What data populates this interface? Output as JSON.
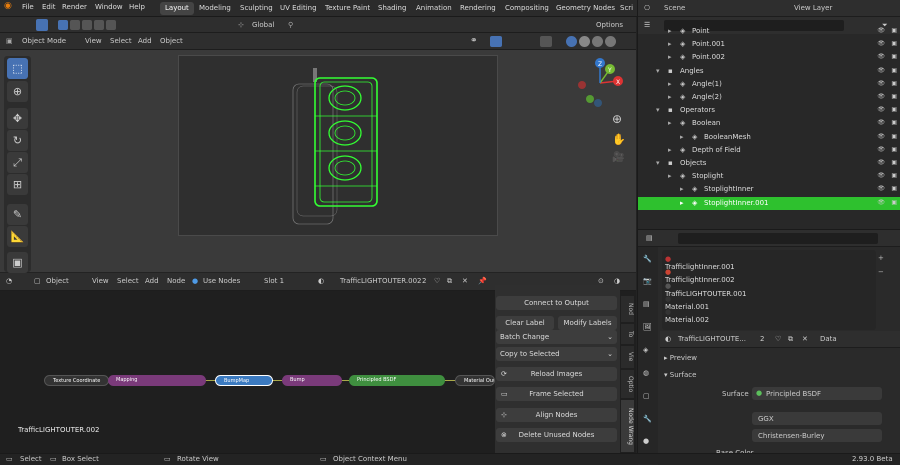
{
  "menu": [
    "File",
    "Edit",
    "Render",
    "Window",
    "Help"
  ],
  "workspace_tabs": [
    "Layout",
    "Modeling",
    "Sculpting",
    "UV Editing",
    "Texture Paint",
    "Shading",
    "Animation",
    "Rendering",
    "Compositing",
    "Geometry Nodes",
    "Scri"
  ],
  "active_tab": "Layout",
  "scene": {
    "label": "Scene",
    "view_layer": "View Layer"
  },
  "tool_header": {
    "orientation": "Global",
    "options": "Options"
  },
  "viewport_header": {
    "mode": "Object Mode",
    "items": [
      "View",
      "Select",
      "Add",
      "Object"
    ]
  },
  "gizmo": {
    "x": "X",
    "y": "Y",
    "z": "Z"
  },
  "outliner": [
    {
      "label": "Point",
      "indent": 2
    },
    {
      "label": "Point.001",
      "indent": 2
    },
    {
      "label": "Point.002",
      "indent": 2
    },
    {
      "label": "Angles",
      "indent": 1
    },
    {
      "label": "Angle(1)",
      "indent": 2
    },
    {
      "label": "Angle(2)",
      "indent": 2
    },
    {
      "label": "Operators",
      "indent": 1
    },
    {
      "label": "Boolean",
      "indent": 2
    },
    {
      "label": "BooleanMesh",
      "indent": 3
    },
    {
      "label": "Depth of Field",
      "indent": 2
    },
    {
      "label": "Objects",
      "indent": 1
    },
    {
      "label": "Stoplight",
      "indent": 2
    },
    {
      "label": "StoplightInner",
      "indent": 3
    },
    {
      "label": "StoplightInner.001",
      "indent": 3
    }
  ],
  "node_header": {
    "object": "Object",
    "items": [
      "View",
      "Select",
      "Add",
      "Node"
    ],
    "use_nodes": "Use Nodes",
    "slot": "Slot 1",
    "material": "TrafficLIGHTOUTER.002",
    "users": "2"
  },
  "nodes": [
    "Texture Coordinate",
    "Mapping",
    "BumpMap",
    "Bump",
    "Principled BSDF",
    "Material Out"
  ],
  "node_material_label": "TrafficLIGHTOUTER.002",
  "side_panel": {
    "connect": "Connect to Output",
    "clear_label": "Clear Label",
    "modify_labels": "Modify Labels",
    "batch_change": "Batch Change",
    "copy_selected": "Copy to Selected",
    "reload_images": "Reload Images",
    "frame_selected": "Frame Selected",
    "align_nodes": "Align Nodes",
    "delete_unused": "Delete Unused Nodes",
    "tabs": [
      "Nod",
      "To",
      "Vie",
      "Optio",
      "Node Wrang"
    ]
  },
  "materials": [
    "TrafficlightInner.001",
    "TrafficlightInner.002",
    "TrafficLIGHTOUTER.001",
    "Material.001",
    "Material.002"
  ],
  "material_slot": {
    "name": "TrafficLIGHTOUTE...",
    "users": "2",
    "link": "Data"
  },
  "properties": {
    "preview": "Preview",
    "surface_panel": "Surface",
    "surface_label": "Surface",
    "surface_value": "Principled BSDF",
    "distribution": "GGX",
    "subsurface": "Christensen-Burley",
    "base_color": "Base Color"
  },
  "status": {
    "select": "Select",
    "box_select": "Box Select",
    "rotate": "Rotate View",
    "context": "Object Context Menu",
    "version": "2.93.0 Beta"
  },
  "colors": {
    "accent": "#4772b3",
    "selected_row": "#2ec12e",
    "wireframe": "#33ff33"
  }
}
